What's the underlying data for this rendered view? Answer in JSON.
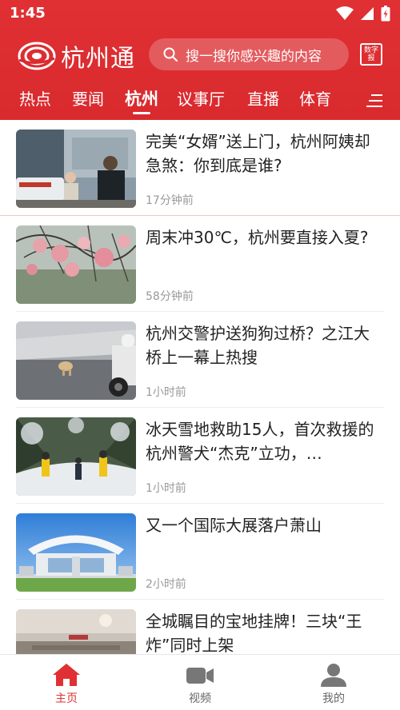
{
  "status_bar": {
    "time": "1:45"
  },
  "header": {
    "logo_text": "杭州通",
    "search_placeholder": "搜一搜你感兴趣的内容",
    "digital_newspaper": "数字报"
  },
  "tabs": [
    {
      "label": "热点",
      "active": false
    },
    {
      "label": "要闻",
      "active": false
    },
    {
      "label": "杭州",
      "active": true
    },
    {
      "label": "议事厅",
      "active": false
    },
    {
      "label": "直播",
      "active": false
    },
    {
      "label": "体育",
      "active": false
    }
  ],
  "news": [
    {
      "title": "完美“女婿”送上门，杭州阿姨却急煞：你到底是谁?",
      "time": "17分钟前"
    },
    {
      "title": "周末冲30℃，杭州要直接入夏?",
      "time": "58分钟前"
    },
    {
      "title": "杭州交警护送狗狗过桥？之江大桥上一幕上热搜",
      "time": "1小时前"
    },
    {
      "title": "冰天雪地救助15人，首次救援的杭州警犬“杰克”立功，…",
      "time": "1小时前"
    },
    {
      "title": "又一个国际大展落户萧山",
      "time": "2小时前"
    },
    {
      "title": "全城瞩目的宝地挂牌！三块“王炸”同时上架",
      "time": ""
    }
  ],
  "bottom_nav": [
    {
      "label": "主页",
      "icon": "home-icon",
      "active": true
    },
    {
      "label": "视频",
      "icon": "video-icon",
      "active": false
    },
    {
      "label": "我的",
      "icon": "profile-icon",
      "active": false
    }
  ],
  "colors": {
    "brand_red": "#e03034",
    "text": "#222222",
    "meta": "#999999"
  }
}
